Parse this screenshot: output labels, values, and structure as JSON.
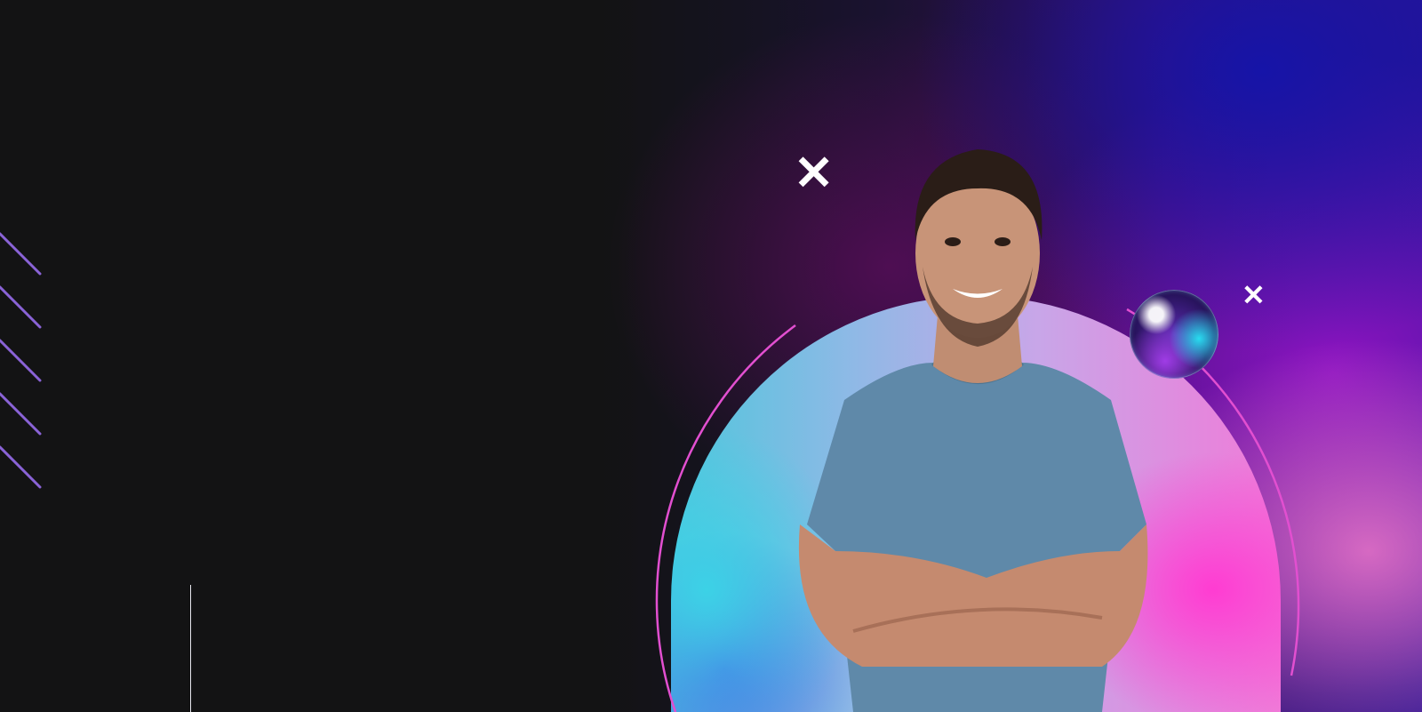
{
  "hero": {
    "decor": {
      "cross_glyph": "✕",
      "accent_colors": {
        "pink_ring": "#e24fd0",
        "purple_lines": "#8a63d6",
        "cyan": "#4fc6dc",
        "magenta": "#ff3cd2"
      },
      "icons": [
        "close-icon",
        "close-icon",
        "orb"
      ]
    }
  }
}
